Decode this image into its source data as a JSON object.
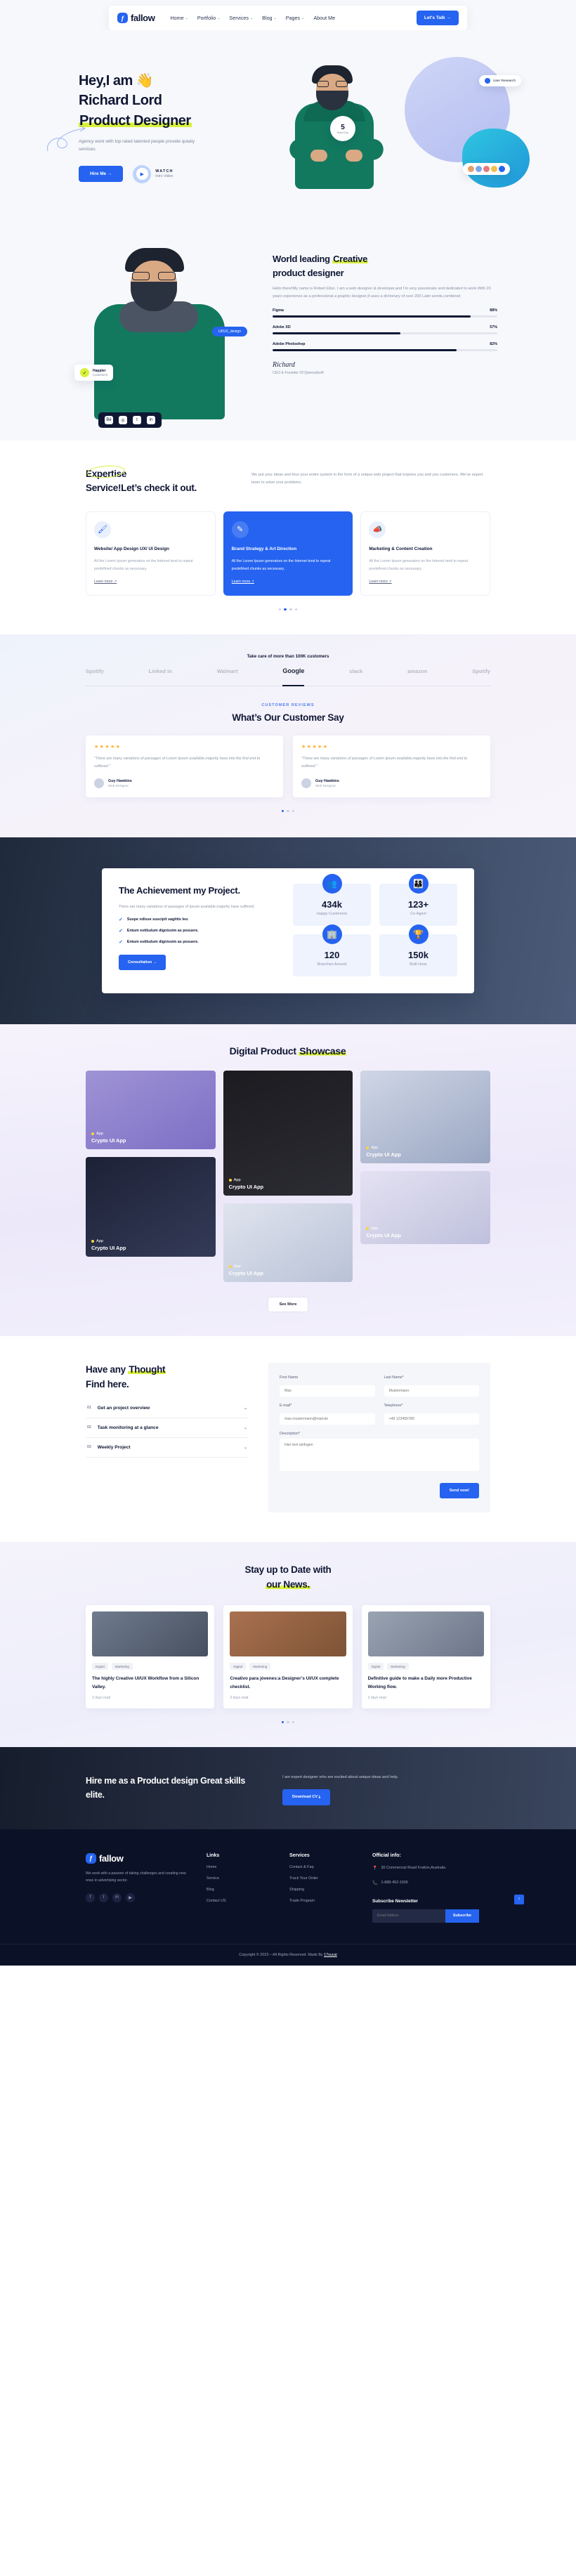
{
  "brand": {
    "name": "fallow",
    "mark": "ƒ",
    "accent": "#2563f0",
    "highlight": "#d9f03a"
  },
  "nav": {
    "items": [
      {
        "label": "Home",
        "caret": "⌄"
      },
      {
        "label": "Portfolio",
        "caret": "⌄"
      },
      {
        "label": "Services",
        "caret": "⌄"
      },
      {
        "label": "Blog",
        "caret": "⌄"
      },
      {
        "label": "Pages",
        "caret": "⌄"
      },
      {
        "label": "About Me",
        "caret": ""
      }
    ],
    "cta": "Let's Talk  →"
  },
  "hero": {
    "line1": "Hey,I am 👋",
    "line2": "Richard Lord",
    "line3_hl": "Product Designer",
    "sub": "Agency work with top rated talented people provide qulaity services.",
    "btn": "Hire Me  →",
    "watch_title": "WATCH",
    "watch_sub": "Intro Video",
    "chip_search": "User Research",
    "badge_num": "5",
    "badge_label": "Years Exp."
  },
  "about": {
    "h2_pre": "World leading ",
    "h2_hl": "Creative",
    "h2_post": "product designer",
    "body": "Hello there!My name is Robert Elisc. I am a web designer & developer,and I'm very passionate and dedicated to work.With 20 years experience as a professional a graphic designer,It uses a dictionary of over 200 Latin words,combined",
    "skills": [
      {
        "name": "Figma",
        "pct": "88%",
        "value": 88
      },
      {
        "name": "Adobe XD",
        "pct": "57%",
        "value": 57
      },
      {
        "name": "Adobe Photoshop",
        "pct": "82%",
        "value": 82
      }
    ],
    "signature": "Richard",
    "role": "CEO & Founder Of Qwensdsoft",
    "pill": "UI/UX_design",
    "happy_1": "Happier",
    "happy_2": "Customers"
  },
  "expertise": {
    "h2_hl": "Expertise",
    "h2_rest": "Service!Let’s check it out.",
    "desc": "We put your ideas and thus your entire system in the form of a unique web project that inspires you and you customers. We’ve expert team to solve your problems.",
    "cards": [
      {
        "icon": "🖌",
        "title": "Website/ App Design UX/ UI Design",
        "body": "All the Lorem Ipsum generators on the Internet tend to repeat predefined chunks as necessary.",
        "link": "Learn more ↗",
        "active": false
      },
      {
        "icon": "✎",
        "title": "Brand Strategy & Art Direction",
        "body": "All the Lorem Ipsum generators on the Internet tend to repeat predefined chunks as necessary.",
        "link": "Learn more ↗",
        "active": true
      },
      {
        "icon": "📣",
        "title": "Marketing & Content Creation",
        "body": "All the Lorem Ipsum generators on the Internet tend to repeat predefined chunks as necessary.",
        "link": "Learn more ↗",
        "active": false
      }
    ]
  },
  "brands": {
    "label": "Take care of more than 100K customers",
    "items": [
      {
        "name": "Spotify",
        "active": false
      },
      {
        "name": "Linked in",
        "active": false
      },
      {
        "name": "Walmart",
        "active": false
      },
      {
        "name": "Google",
        "active": true
      },
      {
        "name": "slack",
        "active": false
      },
      {
        "name": "amazon",
        "active": false
      },
      {
        "name": "Spotify",
        "active": false
      }
    ]
  },
  "reviews": {
    "tag": "CUSTOMER REVIEWS",
    "title": "What’s Our Customer Say",
    "items": [
      {
        "stars": "★★★★★",
        "text": "\"There are many variations of passages of Lorem Ipsum available,majority have into the find end to suffered.\"",
        "name": "Guy Hawkins",
        "role": "Web Designer"
      },
      {
        "stars": "★★★★★",
        "text": "\"There are many variations of passages of Lorem Ipsum available,majority have into the find end to suffered.\"",
        "name": "Guy Hawkins",
        "role": "Web Designer"
      }
    ]
  },
  "achievement": {
    "title": "The Achievement my Project.",
    "desc": "There are many variations of passages of ipsum available,majority have suffered.",
    "bullets": [
      "Suspe ndisse suscipit sagittis leo.",
      "Entum estibulum dignissim as posuere.",
      "Entum estibulum dignissim as posuere."
    ],
    "btn": "Consultation  →",
    "stats": [
      {
        "icon": "👥",
        "num": "434k",
        "label": "Happy Customers"
      },
      {
        "icon": "👨‍👩‍👦",
        "num": "123+",
        "label": "Co-Agent"
      },
      {
        "icon": "🏢",
        "num": "120",
        "label": "Branches Around"
      },
      {
        "icon": "🏆",
        "num": "150k",
        "label": "Built Hose"
      }
    ]
  },
  "showcase": {
    "title_pre": "Digital Product ",
    "title_hl": "Showcase",
    "items": [
      {
        "cat": "App",
        "title": "Crypto UI App"
      },
      {
        "cat": "App",
        "title": "Crypto UI App"
      },
      {
        "cat": "App",
        "title": "Crypto UI App"
      },
      {
        "cat": "App",
        "title": "Crypto UI App"
      },
      {
        "cat": "App",
        "title": "Crypto UI App"
      },
      {
        "cat": "App",
        "title": "Crypto UI App"
      }
    ],
    "btn": "See More"
  },
  "faq": {
    "h2_pre": "Have any ",
    "h2_hl": "Thought",
    "h2_post": "Find here.",
    "rows": [
      {
        "no": "01",
        "label": "Get an project overview"
      },
      {
        "no": "02",
        "label": "Task monitoring at a glance"
      },
      {
        "no": "03",
        "label": "Weekly Project"
      }
    ],
    "form": {
      "first_label": "First Name",
      "first_ph": "Max",
      "last_label": "Last Name*",
      "last_ph": "Mustermann",
      "email_label": "E-mail*",
      "email_ph": "max.mustermann@mail.de",
      "tel_label": "Telephone*",
      "tel_ph": "+49 123456789",
      "desc_label": "Description*",
      "desc_ph": "Hier text ainfugen",
      "send": "Send now!"
    }
  },
  "blog": {
    "h2_pre": "Stay up to Date with",
    "h2_hl": "our News.",
    "posts": [
      {
        "tags": [
          "Digital",
          "Marketing"
        ],
        "title": "The highly Creative UI/UX Workflow from a Silicon Valley.",
        "read": "3 days read"
      },
      {
        "tags": [
          "Digital",
          "Marketing"
        ],
        "title": "Creativo para jóvenes:a Designer’s UI/UX complete checklist.",
        "read": "3 days read"
      },
      {
        "tags": [
          "Digital",
          "Marketing"
        ],
        "title": "Definitive guide to make a Daily more Productive Working flow.",
        "read": "3 days read"
      }
    ]
  },
  "hire": {
    "title": "Hire me as a Product design Great skills elite.",
    "desc": "I am expert designer who are excited about unique ideas and help.",
    "btn": "Download CV ⤓"
  },
  "footer": {
    "about": "We work with a passion of taking challenges and creating new ones in advertising sector.",
    "social": [
      "f",
      "t",
      "in",
      "▶"
    ],
    "links_h": "Links",
    "links": [
      "Home",
      "Service",
      "Blog",
      "Contact US"
    ],
    "services_h": "Services",
    "services": [
      "Contact & Faq",
      "Track Your Order",
      "Shipping",
      "Trade Program"
    ],
    "info_h": "Official info:",
    "address": "30 Commercial Road Fratton,Australia",
    "phone": "1-888-452-1505",
    "sub_h": "Subscribe Newsletter",
    "sub_ph": "Email Addres",
    "sub_btn": "Subscribe",
    "copyright_pre": "Copyright © 2023 – All Rights Reserved. Made By ",
    "copyright_link": "17sucai"
  }
}
